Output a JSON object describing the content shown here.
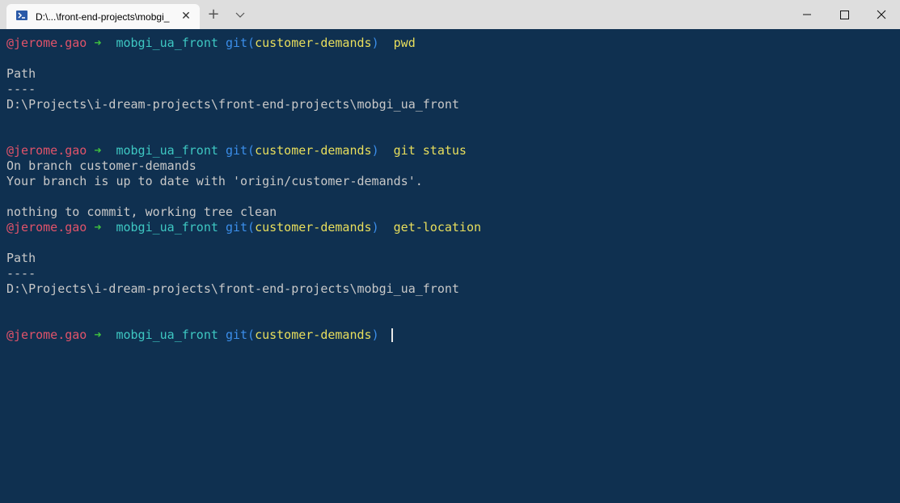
{
  "window": {
    "tab_title": "D:\\...\\front-end-projects\\mobgi_",
    "tab_icon": "powershell-icon",
    "tab_close": "✕",
    "new_tab": "+"
  },
  "colors": {
    "background": "#0f3050",
    "user": "#e0536a",
    "arrow": "#3fc13f",
    "directory": "#3ec7c2",
    "git": "#3b8eea",
    "branch": "#e8de5c",
    "text": "#c8c8c8"
  },
  "prompt": {
    "user": "@jerome.gao",
    "arrow": "➜",
    "dir": "mobgi_ua_front",
    "git": "git(",
    "branch": "customer-demands",
    "close": ")"
  },
  "commands": [
    "pwd",
    "git status",
    "get-location"
  ],
  "output": {
    "path_header": "Path",
    "path_sep": "----",
    "path_value": "D:\\Projects\\i-dream-projects\\front-end-projects\\mobgi_ua_front",
    "status_line1": "On branch customer-demands",
    "status_line2": "Your branch is up to date with 'origin/customer-demands'.",
    "status_line3": "nothing to commit, working tree clean"
  }
}
